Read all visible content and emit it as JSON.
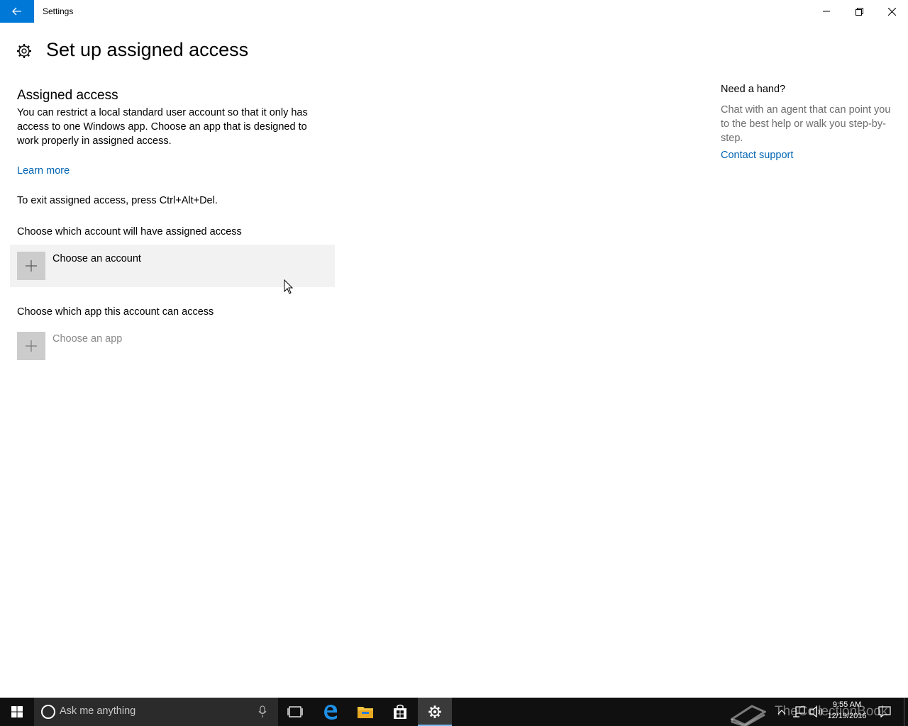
{
  "window": {
    "title": "Settings"
  },
  "header": {
    "title": "Set up assigned access"
  },
  "assigned_access": {
    "heading": "Assigned access",
    "description": "You can restrict a local standard user account so that it only has access to one Windows app. Choose an app that is designed to work properly in assigned access.",
    "learn_more": "Learn more",
    "exit_hint": "To exit assigned access, press Ctrl+Alt+Del.",
    "account_label": "Choose which account will have assigned access",
    "account_button": "Choose an account",
    "app_label": "Choose which app this account can access",
    "app_button": "Choose an app"
  },
  "help": {
    "heading": "Need a hand?",
    "description": "Chat with an agent that can point you to the best help or walk you step-by-step.",
    "contact": "Contact support"
  },
  "taskbar": {
    "search_placeholder": "Ask me anything",
    "watermark": "TheCollectionBook",
    "time": "9:55 AM",
    "date": "12/19/2016",
    "pinned": [
      "task-view-icon",
      "edge-icon",
      "file-explorer-icon",
      "store-icon",
      "settings-icon"
    ]
  },
  "colors": {
    "accent": "#0078d7",
    "link": "#0063b1",
    "taskbar": "#101010"
  }
}
